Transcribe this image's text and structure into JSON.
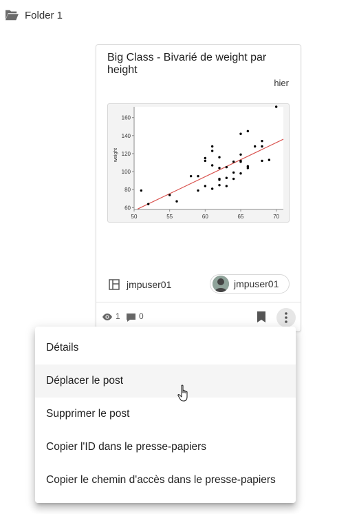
{
  "folder": {
    "name": "Folder 1",
    "icon": "folder-open-icon"
  },
  "card": {
    "title": "Big Class - Bivarié de weight par height",
    "date": "hier",
    "author": "jmpuser01",
    "owner_chip": "jmpuser01",
    "views": "1",
    "comments": "0"
  },
  "chart_data": {
    "type": "scatter",
    "title": "",
    "xlabel": "",
    "ylabel": "weight",
    "xlim": [
      50,
      71
    ],
    "ylim": [
      58,
      172
    ],
    "x_ticks": [
      "50",
      "55",
      "60",
      "65",
      "70"
    ],
    "y_ticks": [
      "60",
      "80",
      "100",
      "120",
      "140",
      "160"
    ],
    "grid": false,
    "points": [
      [
        51,
        79
      ],
      [
        52,
        64
      ],
      [
        55,
        74
      ],
      [
        56,
        67
      ],
      [
        58,
        95
      ],
      [
        59,
        95
      ],
      [
        59,
        79
      ],
      [
        60,
        84
      ],
      [
        60,
        112
      ],
      [
        60,
        115
      ],
      [
        61,
        128
      ],
      [
        61,
        123
      ],
      [
        61,
        107
      ],
      [
        61,
        81
      ],
      [
        62,
        104
      ],
      [
        62,
        116
      ],
      [
        62,
        92
      ],
      [
        62,
        91
      ],
      [
        62,
        85
      ],
      [
        63,
        105
      ],
      [
        63,
        93
      ],
      [
        63,
        84
      ],
      [
        64,
        99
      ],
      [
        64,
        111
      ],
      [
        64,
        92
      ],
      [
        65,
        142
      ],
      [
        65,
        119
      ],
      [
        65,
        111
      ],
      [
        65,
        112
      ],
      [
        65,
        98
      ],
      [
        66,
        145
      ],
      [
        66,
        106
      ],
      [
        66,
        104
      ],
      [
        67,
        128
      ],
      [
        68,
        134
      ],
      [
        68,
        128
      ],
      [
        68,
        112
      ],
      [
        69,
        113
      ],
      [
        70,
        172
      ]
    ],
    "fit_line": {
      "x": [
        50.5,
        71
      ],
      "y": [
        58.5,
        136
      ],
      "color": "#d9534f"
    }
  },
  "menu": {
    "items": [
      {
        "label": "Détails"
      },
      {
        "label": "Déplacer le post"
      },
      {
        "label": "Supprimer le post"
      },
      {
        "label": "Copier l'ID dans le presse-papiers"
      },
      {
        "label": "Copier le chemin d'accès dans le presse-papiers"
      }
    ],
    "hovered_index": 1
  }
}
